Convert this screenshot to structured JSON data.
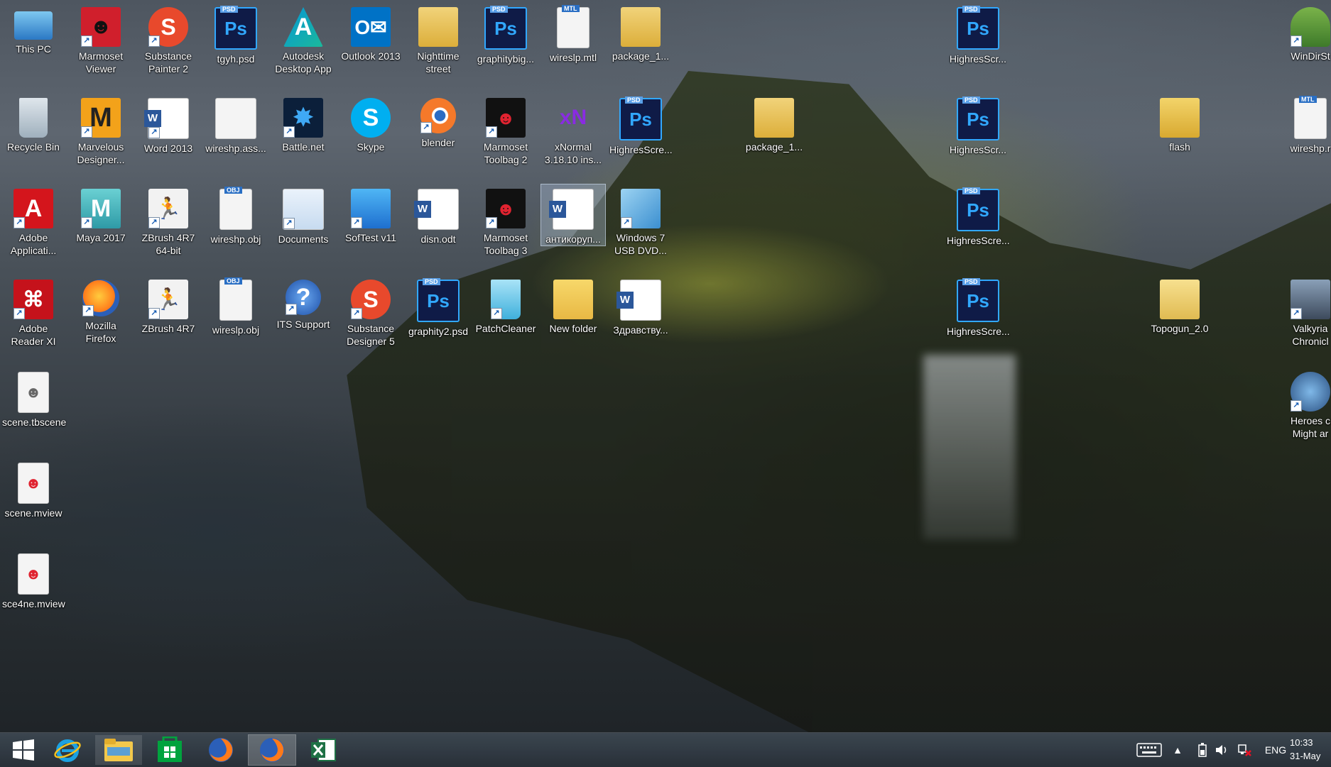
{
  "desktop": {
    "icons": [
      {
        "label": "This PC",
        "icon": "computer-icon"
      },
      {
        "label": "Marmoset Viewer",
        "icon": "marmoset-icon"
      },
      {
        "label": "Substance Painter 2",
        "icon": "substance-icon"
      },
      {
        "label": "tgyh.psd",
        "icon": "psd-icon",
        "tag": "PSD"
      },
      {
        "label": "Autodesk Desktop App",
        "icon": "autodesk-icon"
      },
      {
        "label": "Outlook 2013",
        "icon": "outlook-icon"
      },
      {
        "label": "Nighttime street",
        "icon": "zip-folder-icon"
      },
      {
        "label": "graphitybig...",
        "icon": "psd-icon",
        "tag": "PSD"
      },
      {
        "label": "wireslp.mtl",
        "icon": "mtl-file-icon",
        "tag": "MTL"
      },
      {
        "label": "package_1...",
        "icon": "zip-folder-icon"
      },
      {
        "label": "HighresScr...",
        "icon": "psd-icon",
        "tag": "PSD"
      },
      {
        "label": "WinDirSt",
        "icon": "windirstat-icon"
      },
      {
        "label": "Recycle Bin",
        "icon": "recycle-bin-icon"
      },
      {
        "label": "Marvelous Designer...",
        "icon": "marvelous-icon"
      },
      {
        "label": "Word 2013",
        "icon": "word-icon"
      },
      {
        "label": "wireshp.ass...",
        "icon": "file-icon"
      },
      {
        "label": "Battle.net",
        "icon": "battlenet-icon"
      },
      {
        "label": "Skype",
        "icon": "skype-icon"
      },
      {
        "label": "blender",
        "icon": "blender-icon"
      },
      {
        "label": "Marmoset Toolbag 2",
        "icon": "marmoset-icon"
      },
      {
        "label": "xNormal 3.18.10 ins...",
        "icon": "xnormal-icon"
      },
      {
        "label": "HighresScre...",
        "icon": "psd-icon",
        "tag": "PSD"
      },
      {
        "label": "package_1...",
        "icon": "zip-folder-icon"
      },
      {
        "label": "HighresScr...",
        "icon": "psd-icon",
        "tag": "PSD"
      },
      {
        "label": "flash",
        "icon": "folder-icon"
      },
      {
        "label": "wireshp.r",
        "icon": "mtl-file-icon",
        "tag": "MTL"
      },
      {
        "label": "Adobe Applicati...",
        "icon": "adobe-icon"
      },
      {
        "label": "Maya 2017",
        "icon": "maya-icon"
      },
      {
        "label": "ZBrush 4R7 64-bit",
        "icon": "zbrush-icon"
      },
      {
        "label": "wireshp.obj",
        "icon": "obj-file-icon",
        "tag": "OBJ"
      },
      {
        "label": "Documents",
        "icon": "documents-icon"
      },
      {
        "label": "SofTest v11",
        "icon": "softest-icon"
      },
      {
        "label": "disn.odt",
        "icon": "word-doc-icon"
      },
      {
        "label": "Marmoset Toolbag 3",
        "icon": "marmoset-icon"
      },
      {
        "label": "антикоруп...",
        "icon": "word-doc-icon"
      },
      {
        "label": "Windows 7 USB DVD...",
        "icon": "windows-usb-icon"
      },
      {
        "label": "HighresScre...",
        "icon": "psd-icon",
        "tag": "PSD"
      },
      {
        "label": "Adobe Reader XI",
        "icon": "acrobat-icon"
      },
      {
        "label": "Mozilla Firefox",
        "icon": "firefox-icon"
      },
      {
        "label": "ZBrush 4R7",
        "icon": "zbrush-icon"
      },
      {
        "label": "wireslp.obj",
        "icon": "obj-file-icon",
        "tag": "OBJ"
      },
      {
        "label": "ITS Support",
        "icon": "help-icon"
      },
      {
        "label": "Substance Designer 5",
        "icon": "substance-icon"
      },
      {
        "label": "graphity2.psd",
        "icon": "psd-icon",
        "tag": "PSD"
      },
      {
        "label": "PatchCleaner",
        "icon": "patchcleaner-icon"
      },
      {
        "label": "New folder",
        "icon": "folder-icon"
      },
      {
        "label": "Здравству...",
        "icon": "word-doc-icon"
      },
      {
        "label": "HighresScre...",
        "icon": "psd-icon",
        "tag": "PSD"
      },
      {
        "label": "Topogun_2.0",
        "icon": "folder-icon"
      },
      {
        "label": "Valkyria Chronicl",
        "icon": "game-icon"
      },
      {
        "label": "scene.tbscene",
        "icon": "tbscene-file-icon"
      },
      {
        "label": "Heroes c Might ar",
        "icon": "game-icon"
      },
      {
        "label": "scene.mview",
        "icon": "mview-file-icon"
      },
      {
        "label": "sce4ne.mview",
        "icon": "mview-file-icon"
      }
    ]
  },
  "taskbar": {
    "apps": [
      {
        "name": "start-button",
        "icon": "windows-logo-icon"
      },
      {
        "name": "internet-explorer",
        "icon": "ie-icon"
      },
      {
        "name": "file-explorer",
        "icon": "folder-icon"
      },
      {
        "name": "store",
        "icon": "store-icon"
      },
      {
        "name": "firefox",
        "icon": "firefox-icon"
      },
      {
        "name": "firefox-active",
        "icon": "firefox-icon"
      },
      {
        "name": "excel",
        "icon": "excel-icon"
      }
    ],
    "tray": {
      "language": "ENG",
      "time": "10:33",
      "date": "31-May"
    }
  }
}
